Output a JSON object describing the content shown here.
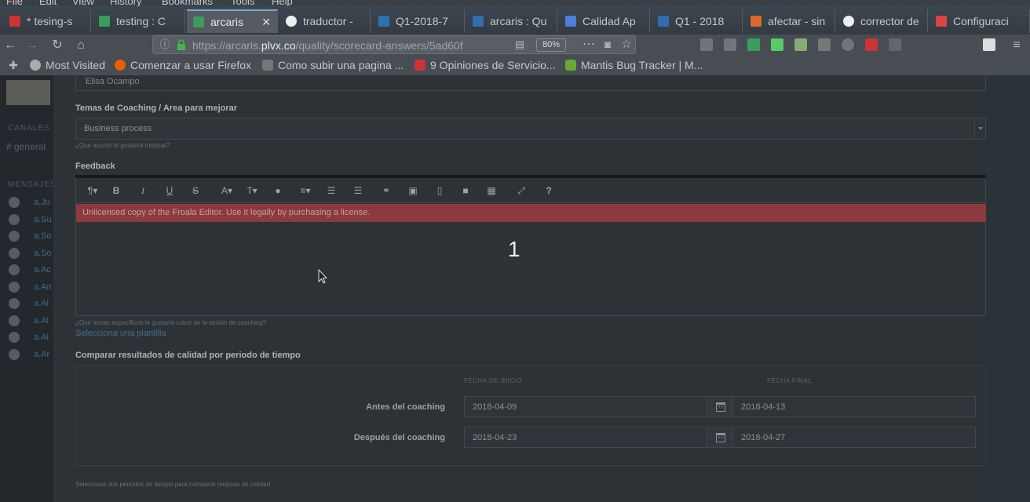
{
  "browser": {
    "menubar": [
      "File",
      "Edit",
      "View",
      "History",
      "Bookmarks",
      "Tools",
      "Help"
    ],
    "tabs": [
      {
        "label": "* tesing-s",
        "color": "#c33"
      },
      {
        "label": "testing : C",
        "color": "#3a9d5c"
      },
      {
        "label": "arcaris",
        "color": "#3a9d5c",
        "active": true
      },
      {
        "label": "traductor -",
        "color": "#eee"
      },
      {
        "label": "Q1-2018-7",
        "color": "#2f6fb0"
      },
      {
        "label": "arcaris : Qu",
        "color": "#2f6fb0"
      },
      {
        "label": "Calidad Ap",
        "color": "#4c7fd8"
      },
      {
        "label": "Q1 - 2018",
        "color": "#2f6fb0"
      },
      {
        "label": "afectar - sin",
        "color": "#d96b2a"
      },
      {
        "label": "corrector de",
        "color": "#eee"
      },
      {
        "label": "Configuraci",
        "color": "#d44"
      }
    ],
    "url_host": "https://arcaris.",
    "url_domain": "plvx.co",
    "url_path": "/quality/scorecard-answers/5ad60f",
    "zoom": "80%",
    "bookmarks": [
      {
        "label": "Most Visited",
        "color": "#aaa"
      },
      {
        "label": "Comenzar a usar Firefox",
        "color": "#e66000"
      },
      {
        "label": "Como subir una pagina ...",
        "color": "#777"
      },
      {
        "label": "9 Opiniones de Servicio...",
        "color": "#c33"
      },
      {
        "label": "Mantis Bug Tracker | M...",
        "color": "#6a3"
      }
    ]
  },
  "sidebar": {
    "channels_header": "CANALES",
    "channel": "# general",
    "messages_header": "MENSAJES",
    "dm_names": [
      "a.Ju",
      "a.Su",
      "a.So",
      "a.So",
      "a.Ac",
      "a.An",
      "a.Al",
      "a.Al",
      "a.Al",
      "a.Ar"
    ]
  },
  "form": {
    "prev_input_value": "Elisa Ocampo",
    "coaching_label": "Temas de Coaching / Area para mejorar",
    "coaching_value": "Business process",
    "coaching_help": "¿Que asunto te gustaría mejorar?",
    "feedback_label": "Feedback",
    "license_notice": "Unlicensed copy of the Froala Editor. Use it legally by purchasing a license.",
    "editor_text": "1",
    "feedback_help": "¿Qué temas específicos te gustaría cubrir en la sesión de coaching?",
    "template_link": "Selecciona una plantilla",
    "compare_label": "Comparar resultados de calidad por periodo de tiempo",
    "col_start": "FECHA DE INICIO",
    "col_end": "FECHA FINAL",
    "rows": [
      {
        "label": "Antes del coaching",
        "start": "2018-04-09",
        "end": "2018-04-13"
      },
      {
        "label": "Después del coaching",
        "start": "2018-04-23",
        "end": "2018-04-27"
      }
    ],
    "compare_help": "Selecciona dos periodos de tiempo para comparar mejoras de calidad"
  },
  "editor_toolbar": {
    "paragraph": "¶",
    "bold": "B",
    "italic": "I",
    "underline": "U",
    "strike": "S",
    "font_family": "A",
    "font_size": "T",
    "help": "?"
  }
}
